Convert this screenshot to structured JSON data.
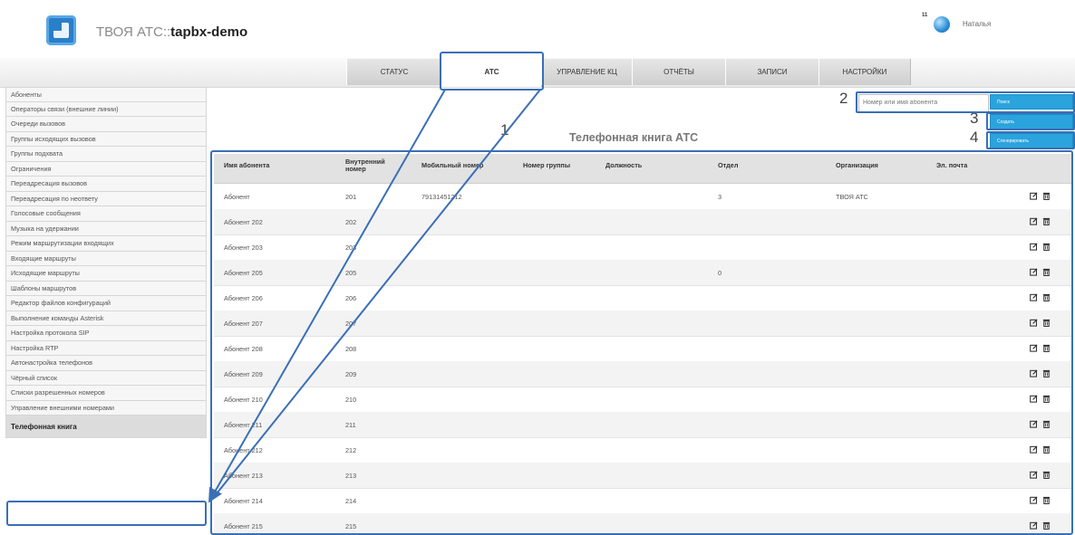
{
  "header": {
    "brand_prefix": "ТВОЯ АТС::",
    "brand_name": "tapbx-demo",
    "user_count": "11",
    "user_name": "Наталья"
  },
  "tabs": [
    {
      "label": "СТАТУС"
    },
    {
      "label": "АТС",
      "active": true
    },
    {
      "label": "УПРАВЛЕНИЕ КЦ"
    },
    {
      "label": "ОТЧЁТЫ"
    },
    {
      "label": "ЗАПИСИ"
    },
    {
      "label": "НАСТРОЙКИ"
    }
  ],
  "sidebar": {
    "items": [
      {
        "label": "Абоненты"
      },
      {
        "label": "Операторы связи (внешние линии)"
      },
      {
        "label": "Очереди вызовов"
      },
      {
        "label": "Группы исходящих вызовов"
      },
      {
        "label": "Группы подхвата"
      },
      {
        "label": "Ограничения"
      },
      {
        "label": "Переадресация вызовов"
      },
      {
        "label": "Переадресация по неответу"
      },
      {
        "label": "Голосовые сообщения"
      },
      {
        "label": "Музыка на удержании"
      },
      {
        "label": "Режим маршрутизации входящих"
      },
      {
        "label": "Входящие маршруты"
      },
      {
        "label": "Исходящие маршруты"
      },
      {
        "label": "Шаблоны маршрутов"
      },
      {
        "label": "Редактор файлов конфигураций"
      },
      {
        "label": "Выполнение команды Asterisk"
      },
      {
        "label": "Настройка протокола SIP"
      },
      {
        "label": "Настройка RTP"
      },
      {
        "label": "Автонастройка телефонов"
      },
      {
        "label": "Чёрный список"
      },
      {
        "label": "Списки разрешенных номеров"
      },
      {
        "label": "Управление внешними номерами"
      },
      {
        "label": "Телефонная книга",
        "active": true
      }
    ]
  },
  "toolbar": {
    "search_placeholder": "Номер или имя абонента",
    "search_button": "Поиск",
    "create_button": "Создать",
    "generate_button": "Сгенерировать"
  },
  "callouts": {
    "n1": "1",
    "n2": "2",
    "n3": "3",
    "n4": "4"
  },
  "page_title": "Телефонная книга АТС",
  "table": {
    "columns": [
      "Имя абонента",
      "Внутренний номер",
      "Мобильный номер",
      "Номер группы",
      "Должность",
      "Отдел",
      "Организация",
      "Эл. почта"
    ],
    "rows": [
      [
        "Абонент",
        "201",
        "79131451212",
        "",
        "",
        "3",
        "ТВОЯ АТС",
        ""
      ],
      [
        "Абонент 202",
        "202",
        "",
        "",
        "",
        "",
        "",
        ""
      ],
      [
        "Абонент 203",
        "203",
        "",
        "",
        "",
        "",
        "",
        ""
      ],
      [
        "Абонент 205",
        "205",
        "",
        "",
        "",
        "0",
        "",
        ""
      ],
      [
        "Абонент 206",
        "206",
        "",
        "",
        "",
        "",
        "",
        ""
      ],
      [
        "Абонент 207",
        "207",
        "",
        "",
        "",
        "",
        "",
        ""
      ],
      [
        "Абонент 208",
        "208",
        "",
        "",
        "",
        "",
        "",
        ""
      ],
      [
        "Абонент 209",
        "209",
        "",
        "",
        "",
        "",
        "",
        ""
      ],
      [
        "Абонент 210",
        "210",
        "",
        "",
        "",
        "",
        "",
        ""
      ],
      [
        "Абонент 211",
        "211",
        "",
        "",
        "",
        "",
        "",
        ""
      ],
      [
        "Абонент 212",
        "212",
        "",
        "",
        "",
        "",
        "",
        ""
      ],
      [
        "Абонент 213",
        "213",
        "",
        "",
        "",
        "",
        "",
        ""
      ],
      [
        "Абонент 214",
        "214",
        "",
        "",
        "",
        "",
        "",
        ""
      ],
      [
        "Абонент 215",
        "215",
        "",
        "",
        "",
        "",
        "",
        ""
      ]
    ],
    "row_actions": [
      "edit-icon",
      "delete-icon"
    ]
  },
  "colors": {
    "accent": "#2ba3dc",
    "highlight": "#3a6fb6",
    "tab_bg": "#d6d6d6",
    "header_row": "#e2e2e2"
  }
}
